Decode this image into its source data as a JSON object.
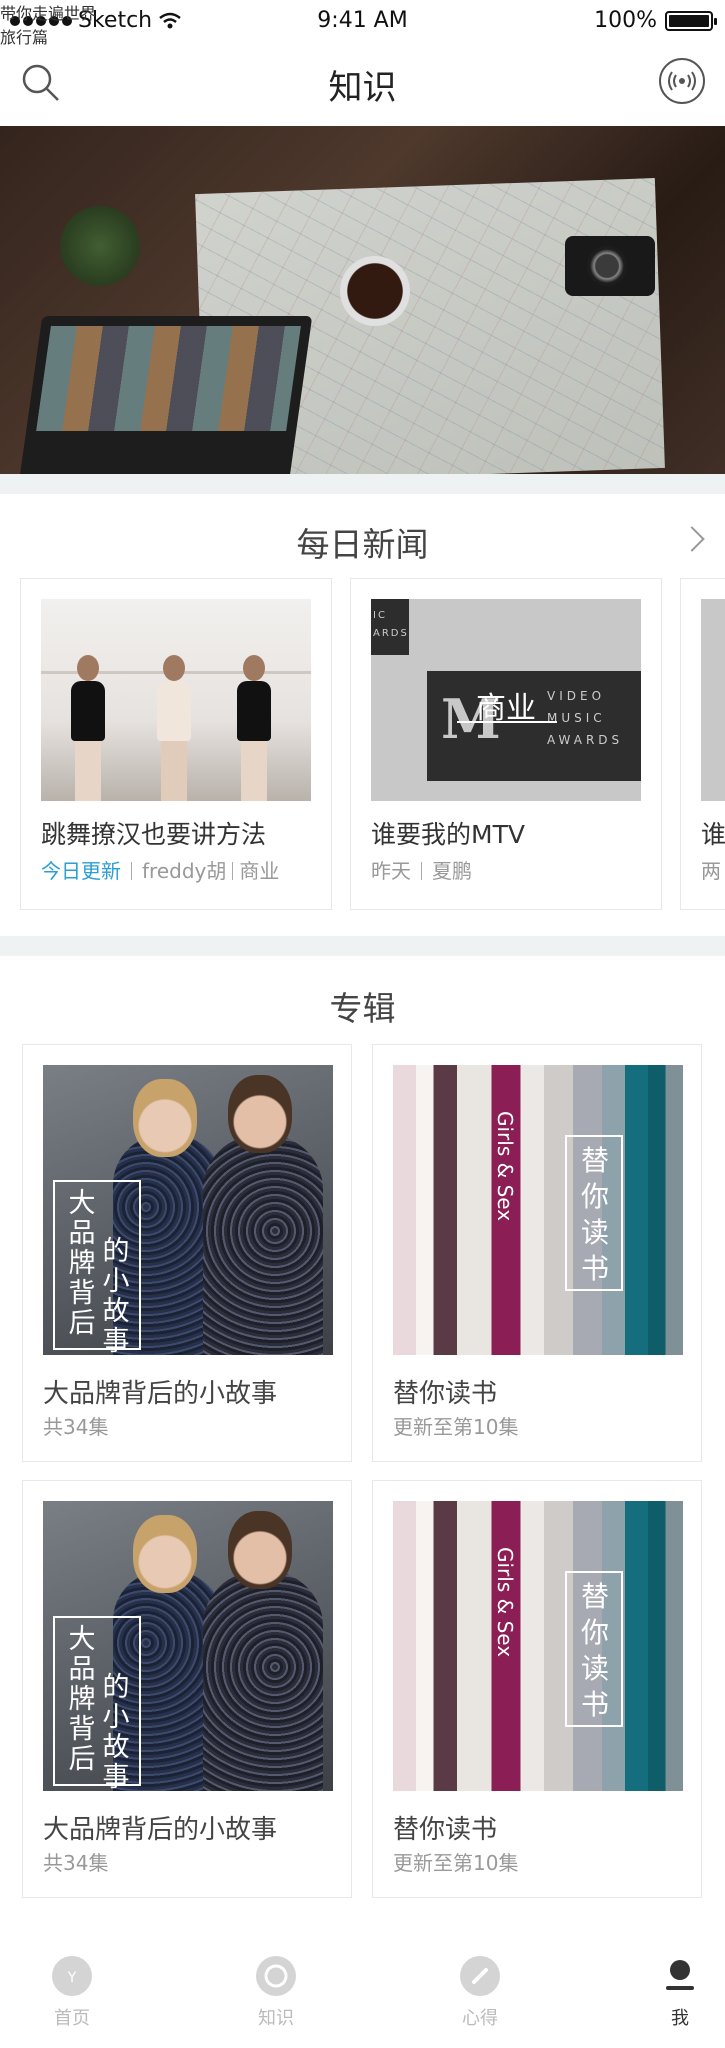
{
  "status": {
    "carrier": "Sketch",
    "time": "9:41 AM",
    "battery": "100%"
  },
  "nav": {
    "title": "知识",
    "search_icon": "search-icon",
    "radio_icon": "radio-broadcast-icon"
  },
  "banner": {
    "headline": "带你走遍世界",
    "tag": "旅行篇"
  },
  "news": {
    "title": "每日新闻",
    "items": [
      {
        "title": "跳舞撩汉也要讲方法",
        "today": "今日更新",
        "author": "freddy胡",
        "category": "商业"
      },
      {
        "title": "谁要我的MTV",
        "overlay": "商业",
        "date": "昨天",
        "author": "夏鹏"
      },
      {
        "title": "谁",
        "date": "两"
      }
    ]
  },
  "album": {
    "title": "专辑",
    "items": [
      {
        "title": "大品牌背后的小故事",
        "meta": "共34集",
        "overlay_a": "大品牌背后",
        "overlay_b": "的小故事"
      },
      {
        "title": "替你读书",
        "meta": "更新至第10集",
        "overlay": "替你读书",
        "spine_text": "Girls & Sex"
      },
      {
        "title": "大品牌背后的小故事",
        "meta": "共34集",
        "overlay_a": "大品牌背后",
        "overlay_b": "的小故事"
      },
      {
        "title": "替你读书",
        "meta": "更新至第10集",
        "overlay": "替你读书",
        "spine_text": "Girls & Sex"
      }
    ]
  },
  "mtv_image": {
    "corner": "IC ARDS",
    "lines": [
      "VIDEO",
      "MUSIC",
      "AWARDS"
    ],
    "logo": "M"
  },
  "tabs": [
    {
      "label": "首页",
      "icon": "home-icon",
      "active": false
    },
    {
      "label": "知识",
      "icon": "knowledge-icon",
      "active": false
    },
    {
      "label": "心得",
      "icon": "pencil-icon",
      "active": false
    },
    {
      "label": "我",
      "icon": "profile-icon",
      "active": true
    }
  ]
}
